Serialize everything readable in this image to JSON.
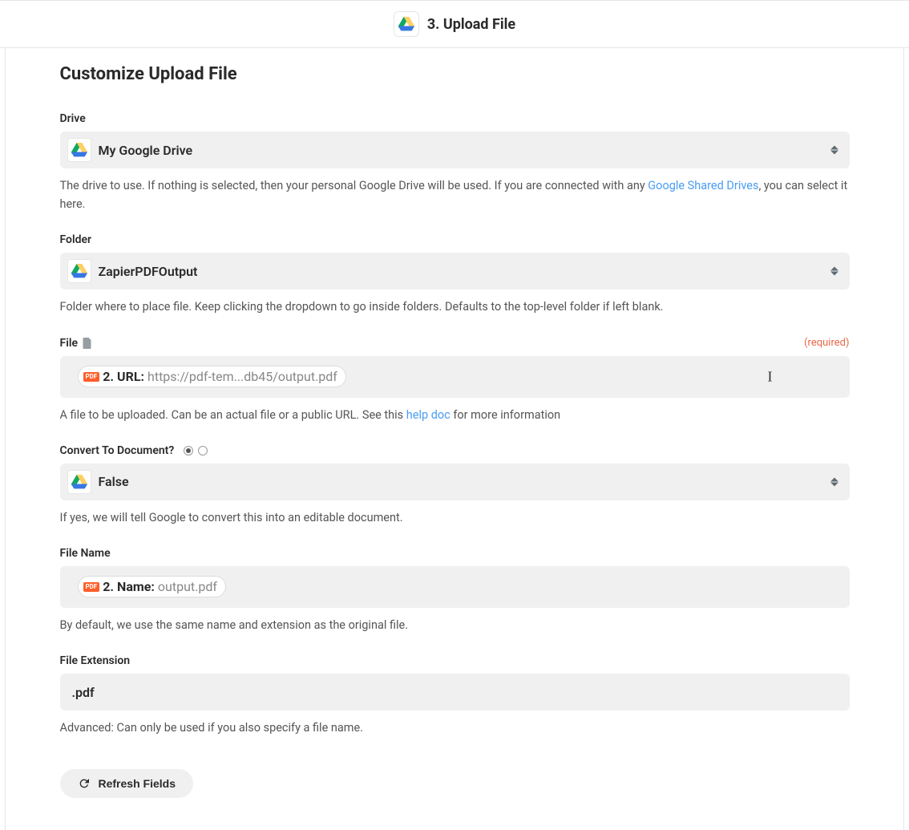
{
  "header": {
    "title": "3. Upload File"
  },
  "section_title": "Customize Upload File",
  "fields": {
    "drive": {
      "label": "Drive",
      "value": "My Google Drive",
      "help_pre": "The drive to use. If nothing is selected, then your personal Google Drive will be used. If you are connected with any ",
      "help_link": "Google Shared Drives",
      "help_post": ", you can select it here."
    },
    "folder": {
      "label": "Folder",
      "value": "ZapierPDFOutput",
      "help": "Folder where to place file. Keep clicking the dropdown to go inside folders. Defaults to the top-level folder if left blank."
    },
    "file": {
      "label": "File",
      "required": "(required)",
      "pill_icon": "PDF",
      "pill_key": "2. URL: ",
      "pill_val": "https://pdf-tem...db45/output.pdf",
      "help_pre": "A file to be uploaded. Can be an actual file or a public URL. See this ",
      "help_link": "help doc",
      "help_post": " for more information"
    },
    "convert": {
      "label": "Convert To Document?",
      "value": "False",
      "help": "If yes, we will tell Google to convert this into an editable document."
    },
    "filename": {
      "label": "File Name",
      "pill_icon": "PDF",
      "pill_key": "2. Name: ",
      "pill_val": "output.pdf",
      "help": "By default, we use the same name and extension as the original file."
    },
    "extension": {
      "label": "File Extension",
      "value": ".pdf",
      "help": "Advanced: Can only be used if you also specify a file name."
    }
  },
  "refresh_label": "Refresh Fields"
}
